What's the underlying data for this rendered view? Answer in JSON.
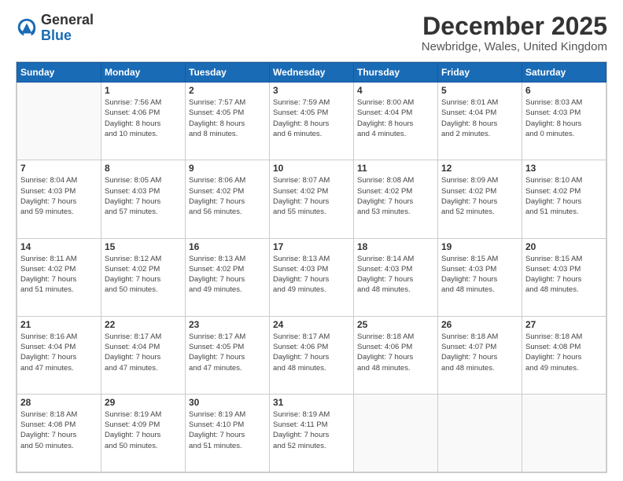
{
  "logo": {
    "general": "General",
    "blue": "Blue"
  },
  "title": "December 2025",
  "location": "Newbridge, Wales, United Kingdom",
  "days_of_week": [
    "Sunday",
    "Monday",
    "Tuesday",
    "Wednesday",
    "Thursday",
    "Friday",
    "Saturday"
  ],
  "weeks": [
    [
      {
        "day": "",
        "info": ""
      },
      {
        "day": "1",
        "info": "Sunrise: 7:56 AM\nSunset: 4:06 PM\nDaylight: 8 hours\nand 10 minutes."
      },
      {
        "day": "2",
        "info": "Sunrise: 7:57 AM\nSunset: 4:05 PM\nDaylight: 8 hours\nand 8 minutes."
      },
      {
        "day": "3",
        "info": "Sunrise: 7:59 AM\nSunset: 4:05 PM\nDaylight: 8 hours\nand 6 minutes."
      },
      {
        "day": "4",
        "info": "Sunrise: 8:00 AM\nSunset: 4:04 PM\nDaylight: 8 hours\nand 4 minutes."
      },
      {
        "day": "5",
        "info": "Sunrise: 8:01 AM\nSunset: 4:04 PM\nDaylight: 8 hours\nand 2 minutes."
      },
      {
        "day": "6",
        "info": "Sunrise: 8:03 AM\nSunset: 4:03 PM\nDaylight: 8 hours\nand 0 minutes."
      }
    ],
    [
      {
        "day": "7",
        "info": "Sunrise: 8:04 AM\nSunset: 4:03 PM\nDaylight: 7 hours\nand 59 minutes."
      },
      {
        "day": "8",
        "info": "Sunrise: 8:05 AM\nSunset: 4:03 PM\nDaylight: 7 hours\nand 57 minutes."
      },
      {
        "day": "9",
        "info": "Sunrise: 8:06 AM\nSunset: 4:02 PM\nDaylight: 7 hours\nand 56 minutes."
      },
      {
        "day": "10",
        "info": "Sunrise: 8:07 AM\nSunset: 4:02 PM\nDaylight: 7 hours\nand 55 minutes."
      },
      {
        "day": "11",
        "info": "Sunrise: 8:08 AM\nSunset: 4:02 PM\nDaylight: 7 hours\nand 53 minutes."
      },
      {
        "day": "12",
        "info": "Sunrise: 8:09 AM\nSunset: 4:02 PM\nDaylight: 7 hours\nand 52 minutes."
      },
      {
        "day": "13",
        "info": "Sunrise: 8:10 AM\nSunset: 4:02 PM\nDaylight: 7 hours\nand 51 minutes."
      }
    ],
    [
      {
        "day": "14",
        "info": "Sunrise: 8:11 AM\nSunset: 4:02 PM\nDaylight: 7 hours\nand 51 minutes."
      },
      {
        "day": "15",
        "info": "Sunrise: 8:12 AM\nSunset: 4:02 PM\nDaylight: 7 hours\nand 50 minutes."
      },
      {
        "day": "16",
        "info": "Sunrise: 8:13 AM\nSunset: 4:02 PM\nDaylight: 7 hours\nand 49 minutes."
      },
      {
        "day": "17",
        "info": "Sunrise: 8:13 AM\nSunset: 4:03 PM\nDaylight: 7 hours\nand 49 minutes."
      },
      {
        "day": "18",
        "info": "Sunrise: 8:14 AM\nSunset: 4:03 PM\nDaylight: 7 hours\nand 48 minutes."
      },
      {
        "day": "19",
        "info": "Sunrise: 8:15 AM\nSunset: 4:03 PM\nDaylight: 7 hours\nand 48 minutes."
      },
      {
        "day": "20",
        "info": "Sunrise: 8:15 AM\nSunset: 4:03 PM\nDaylight: 7 hours\nand 48 minutes."
      }
    ],
    [
      {
        "day": "21",
        "info": "Sunrise: 8:16 AM\nSunset: 4:04 PM\nDaylight: 7 hours\nand 47 minutes."
      },
      {
        "day": "22",
        "info": "Sunrise: 8:17 AM\nSunset: 4:04 PM\nDaylight: 7 hours\nand 47 minutes."
      },
      {
        "day": "23",
        "info": "Sunrise: 8:17 AM\nSunset: 4:05 PM\nDaylight: 7 hours\nand 47 minutes."
      },
      {
        "day": "24",
        "info": "Sunrise: 8:17 AM\nSunset: 4:06 PM\nDaylight: 7 hours\nand 48 minutes."
      },
      {
        "day": "25",
        "info": "Sunrise: 8:18 AM\nSunset: 4:06 PM\nDaylight: 7 hours\nand 48 minutes."
      },
      {
        "day": "26",
        "info": "Sunrise: 8:18 AM\nSunset: 4:07 PM\nDaylight: 7 hours\nand 48 minutes."
      },
      {
        "day": "27",
        "info": "Sunrise: 8:18 AM\nSunset: 4:08 PM\nDaylight: 7 hours\nand 49 minutes."
      }
    ],
    [
      {
        "day": "28",
        "info": "Sunrise: 8:18 AM\nSunset: 4:08 PM\nDaylight: 7 hours\nand 50 minutes."
      },
      {
        "day": "29",
        "info": "Sunrise: 8:19 AM\nSunset: 4:09 PM\nDaylight: 7 hours\nand 50 minutes."
      },
      {
        "day": "30",
        "info": "Sunrise: 8:19 AM\nSunset: 4:10 PM\nDaylight: 7 hours\nand 51 minutes."
      },
      {
        "day": "31",
        "info": "Sunrise: 8:19 AM\nSunset: 4:11 PM\nDaylight: 7 hours\nand 52 minutes."
      },
      {
        "day": "",
        "info": ""
      },
      {
        "day": "",
        "info": ""
      },
      {
        "day": "",
        "info": ""
      }
    ]
  ]
}
